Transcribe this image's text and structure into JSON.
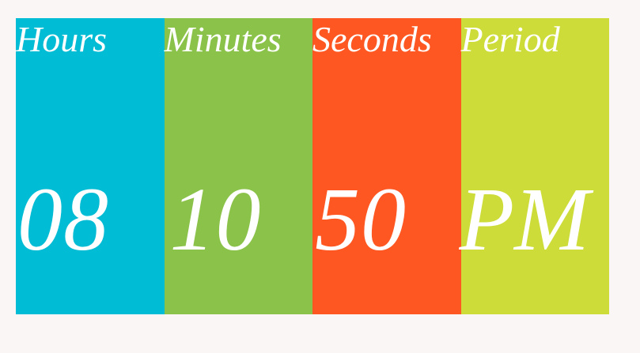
{
  "clock": {
    "panels": [
      {
        "label": "Hours",
        "value": "08",
        "color": "#00bcd4"
      },
      {
        "label": "Minutes",
        "value": "10",
        "color": "#8bc34a"
      },
      {
        "label": "Seconds",
        "value": "50",
        "color": "#ff5722"
      },
      {
        "label": "Period",
        "value": "PM",
        "color": "#cddc39"
      }
    ]
  }
}
